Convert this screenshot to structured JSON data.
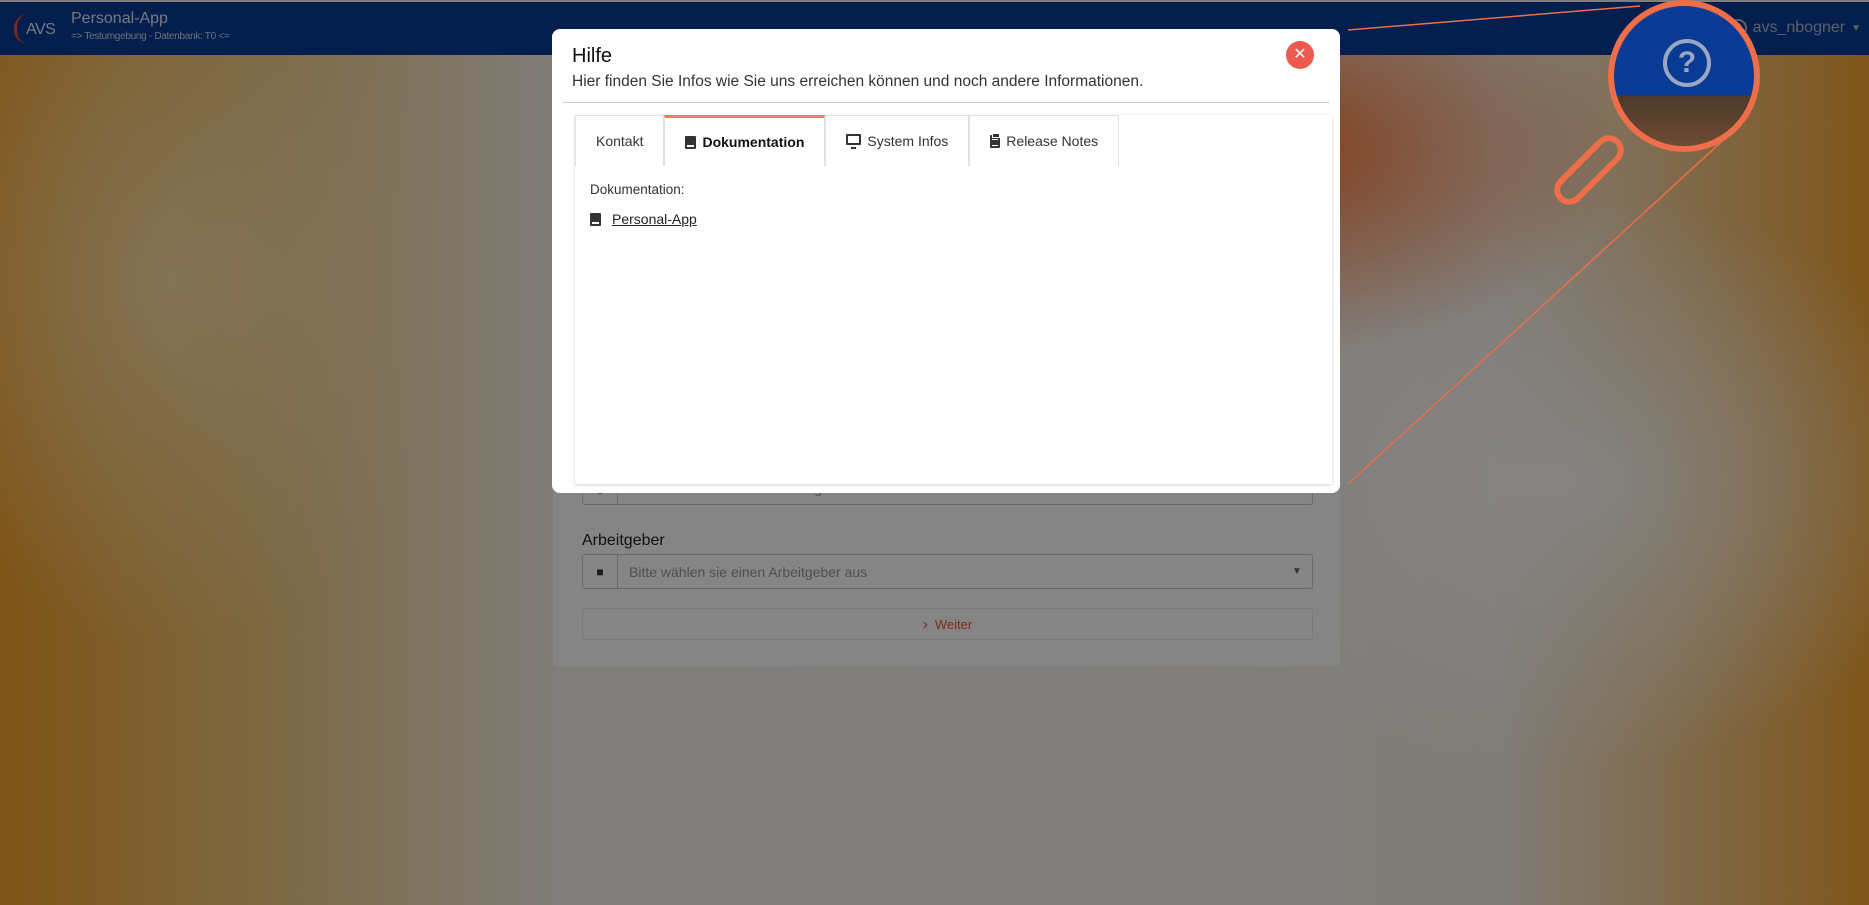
{
  "navbar": {
    "logo_text": "AVS",
    "app_title": "Personal-App",
    "app_subtitle": "=> Testumgebung - Datenbank: T0 <=",
    "username": "avs_nbogner"
  },
  "background_form": {
    "herausgeber_placeholder": "Bitte wählen sie einen Herausgeber aus",
    "arbeitgeber_label": "Arbeitgeber",
    "arbeitgeber_placeholder": "Bitte wählen sie einen Arbeitgeber aus",
    "weiter_label": "Weiter"
  },
  "modal": {
    "title": "Hilfe",
    "subtitle": "Hier finden Sie Infos wie Sie uns erreichen können und noch andere Informationen.",
    "close_icon": "close-icon",
    "active_tab": "Dokumentation",
    "tabs": [
      {
        "label": "Kontakt",
        "icon": ""
      },
      {
        "label": "Dokumentation",
        "icon": "book-icon"
      },
      {
        "label": "System Infos",
        "icon": "monitor-icon"
      },
      {
        "label": "Release Notes",
        "icon": "clipboard-icon"
      }
    ],
    "documentation": {
      "heading": "Dokumentation:",
      "links": [
        {
          "label": "Personal-App",
          "icon": "book-icon"
        }
      ]
    }
  },
  "magnifier": {
    "icon": "question-circle-icon",
    "symbol": "?"
  },
  "colors": {
    "navbar": "#093a94",
    "accent": "#ef6e4a",
    "close": "#ea5a4e",
    "active_tab_border": "#ef7e50"
  }
}
